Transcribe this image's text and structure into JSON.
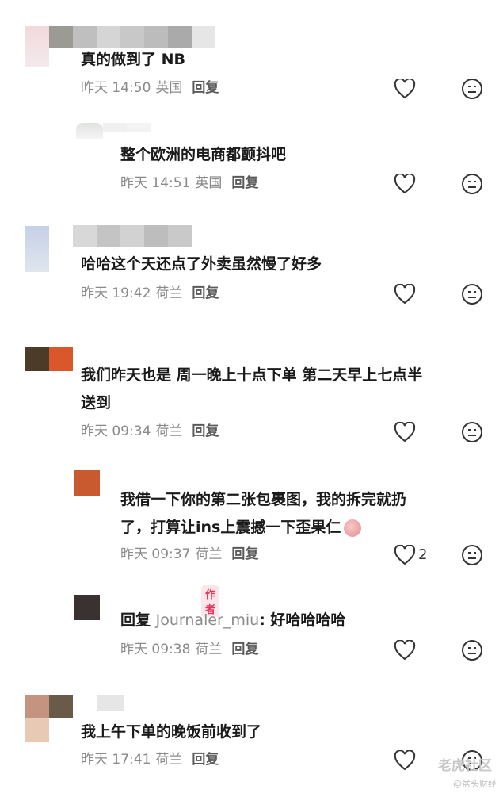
{
  "comments": [
    {
      "text_lines": [
        "真的做到了 NB"
      ],
      "time": "昨天 14:50",
      "location": "英国",
      "reply_label": "回复"
    },
    {
      "text_lines": [
        "整个欧洲的电商都颤抖吧"
      ],
      "time": "昨天 14:51",
      "location": "英国",
      "reply_label": "回复"
    },
    {
      "text_lines": [
        "哈哈这个天还点了外卖虽然慢了好多"
      ],
      "time": "昨天 19:42",
      "location": "荷兰",
      "reply_label": "回复"
    },
    {
      "text_lines": [
        "我们昨天也是 周一晚上十点下单 第二天早上七点半",
        "送到"
      ],
      "time": "昨天 09:34",
      "location": "荷兰",
      "reply_label": "回复"
    },
    {
      "text_lines": [
        "我借一下你的第二张包裹图，我的拆完就扔",
        "了，打算让ins上震撼一下歪果仁"
      ],
      "time": "昨天 09:37",
      "location": "荷兰",
      "reply_label": "回复",
      "like_count": "2"
    },
    {
      "author_tag": "作者",
      "reply_prefix": "回复",
      "reply_to": "Journaler_miu",
      "text": ": 好哈哈哈哈",
      "time": "昨天 09:38",
      "location": "荷兰",
      "reply_label": "回复"
    },
    {
      "text_lines": [
        "我上午下单的晚饭前收到了"
      ],
      "time": "昨天 17:41",
      "location": "荷兰",
      "reply_label": "回复"
    }
  ],
  "watermark": {
    "main": "老虎社区",
    "sub": "@盆头财经"
  },
  "icons": {
    "like": "heart-icon",
    "dislike": "neutral-face-icon"
  }
}
